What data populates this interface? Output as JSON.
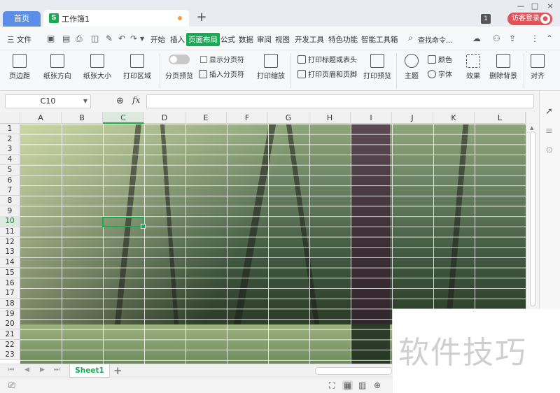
{
  "titlebar": {
    "home_tab": "首页",
    "doc_tab": "工作簿1",
    "doc_logo": "S",
    "new_tab": "+",
    "window_badge": "1",
    "guest_login": "访客登录",
    "minimize": "—",
    "maximize": "□",
    "close": "×"
  },
  "menu": {
    "file": "三 文件",
    "tabs": [
      "开始",
      "插入",
      "页面布局",
      "公式",
      "数据",
      "审阅",
      "视图",
      "开发工具",
      "特色功能",
      "智能工具箱"
    ],
    "active_tab": "页面布局",
    "search": "查找命令..."
  },
  "ribbon": {
    "margins": "页边距",
    "orientation": "纸张方向",
    "size": "纸张大小",
    "print_area": "打印区域",
    "page_break_preview": "分页预览",
    "show_page_breaks": "显示分页符",
    "insert_page_break": "插入分页符",
    "print_scale": "打印缩放",
    "print_titles": "打印标题或表头",
    "print_header_footer": "打印页眉和页脚",
    "print_preview": "打印预览",
    "theme": "主题",
    "colors": "颜色",
    "fonts": "字体",
    "effects": "效果",
    "remove_background": "删除背景",
    "align": "对齐"
  },
  "formula": {
    "cell_ref": "C10",
    "fx": "fx",
    "value": ""
  },
  "sheet": {
    "columns": [
      "A",
      "B",
      "C",
      "D",
      "E",
      "F",
      "G",
      "H",
      "I",
      "J",
      "K",
      "L"
    ],
    "selected_column": "C",
    "rows": [
      "1",
      "2",
      "3",
      "4",
      "5",
      "6",
      "7",
      "8",
      "9",
      "10",
      "11",
      "12",
      "13",
      "14",
      "15",
      "16",
      "17",
      "18",
      "19",
      "20",
      "21",
      "22",
      "23"
    ],
    "selected_row": "10"
  },
  "sheettabs": {
    "sheet1": "Sheet1",
    "add": "+"
  },
  "watermark": "软件技巧",
  "colors": {
    "accent": "#1aaa55",
    "home_tab": "#5b8ee6",
    "guest_button": "#e0535a"
  }
}
